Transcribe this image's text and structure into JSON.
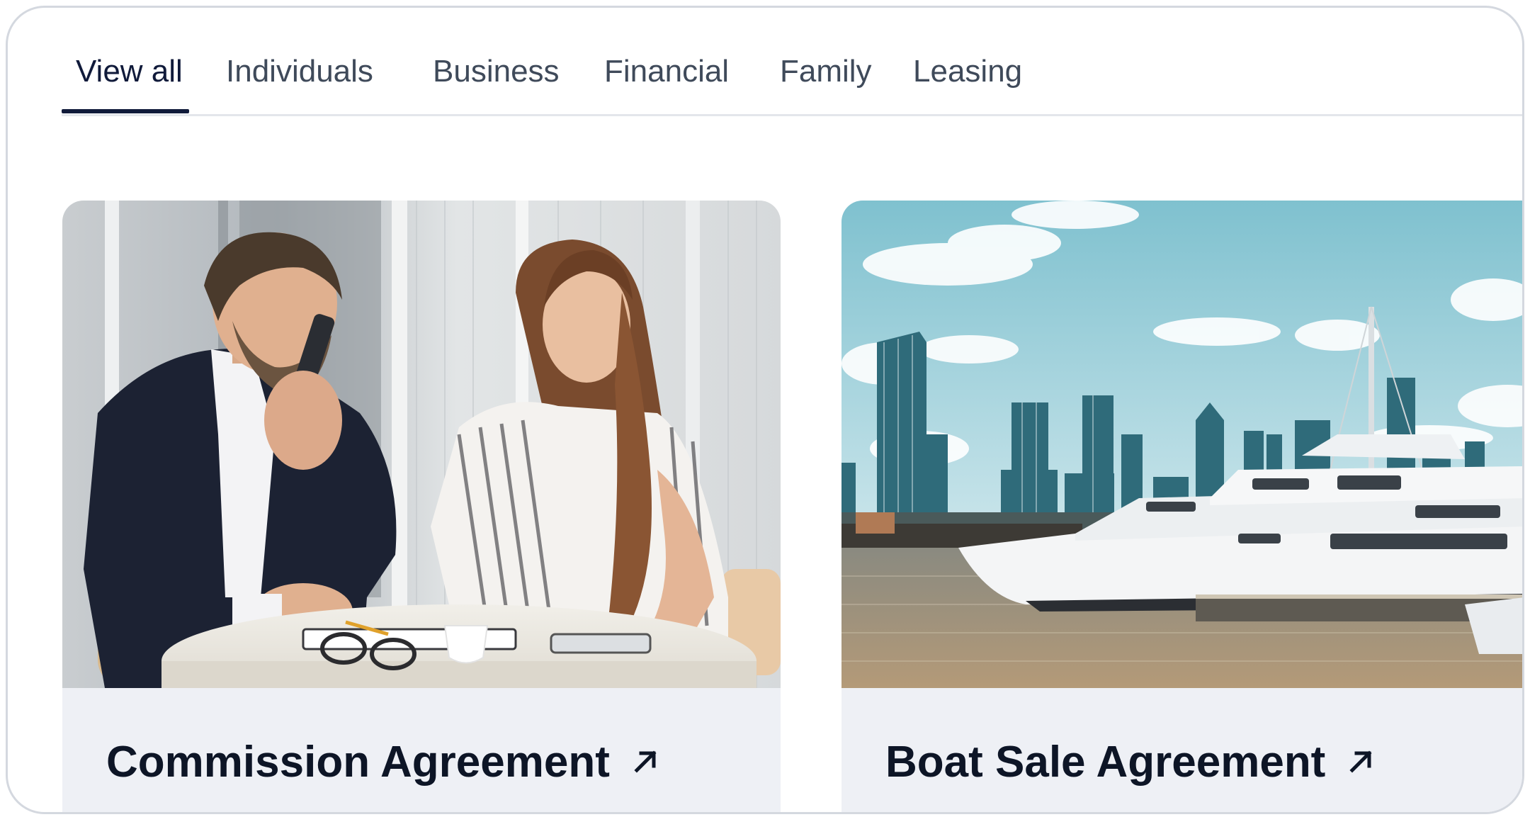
{
  "tabs": [
    {
      "label": "View all",
      "active": true
    },
    {
      "label": "Individuals",
      "active": false
    },
    {
      "label": "Business",
      "active": false
    },
    {
      "label": "Financial",
      "active": false
    },
    {
      "label": "Family",
      "active": false
    },
    {
      "label": "Leasing",
      "active": false
    }
  ],
  "cards": [
    {
      "title": "Commission Agreement",
      "image": "office-meeting-photo",
      "icon": "arrow-up-right-icon"
    },
    {
      "title": "Boat Sale Agreement",
      "image": "yacht-harbor-skyline-photo",
      "icon": "arrow-up-right-icon"
    }
  ],
  "colors": {
    "active_tab": "#101a3a",
    "inactive_tab": "#3f4a5a",
    "card_background": "#eef0f5",
    "title": "#0d1526"
  }
}
